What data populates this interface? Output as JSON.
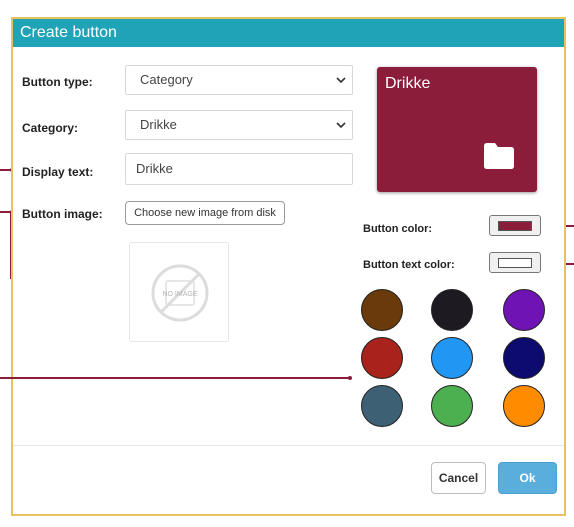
{
  "dialog": {
    "title": "Create button"
  },
  "form": {
    "button_type_label": "Button type:",
    "button_type_value": "Category",
    "category_label": "Category:",
    "category_value": "Drikke",
    "display_text_label": "Display text:",
    "display_text_value": "Drikke",
    "button_image_label": "Button image:",
    "choose_image_label": "Choose new image from disk",
    "no_image_text": "NO IMAGE"
  },
  "preview": {
    "text": "Drikke",
    "background_color": "#8b1c3a",
    "icon": "folder-icon"
  },
  "colors": {
    "button_color_label": "Button color:",
    "button_color": "#8b1c3a",
    "button_text_color_label": "Button text color:",
    "button_text_color": "#ffffff",
    "palette": [
      "#6b3a0a",
      "#1e1a22",
      "#6f13b5",
      "#a8231c",
      "#2196f3",
      "#0d0b6e",
      "#3d6075",
      "#4caf50",
      "#ff8c00"
    ]
  },
  "footer": {
    "cancel_label": "Cancel",
    "ok_label": "Ok"
  }
}
